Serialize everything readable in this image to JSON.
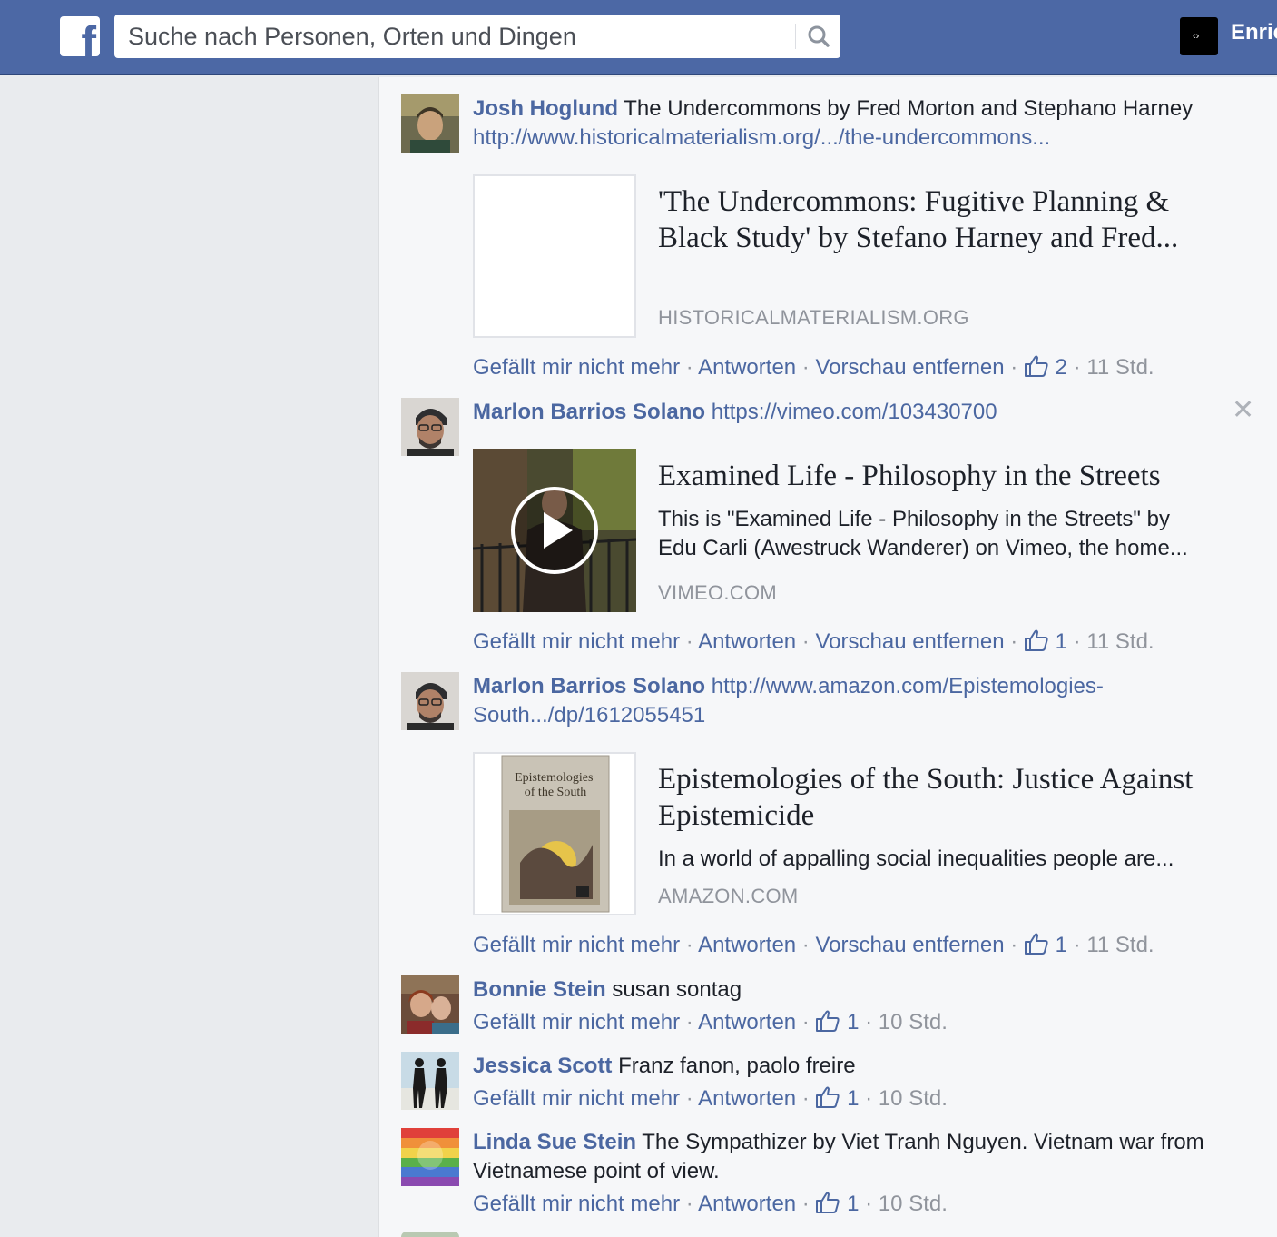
{
  "topbar": {
    "logo_letter": "f",
    "search_placeholder": "Suche nach Personen, Orten und Dingen",
    "user_name": "Enric"
  },
  "actions": {
    "unlike": "Gefällt mir nicht mehr",
    "reply": "Antworten",
    "remove_preview": "Vorschau entfernen",
    "sep": " · "
  },
  "comments": [
    {
      "author": "Josh Hoglund",
      "text": "The Undercommons by Fred Morton and Stephano Harney",
      "link": "http://www.historicalmaterialism.org/.../the-undercommons...",
      "preview": {
        "title": "'The Undercommons: Fugitive Planning & Black Study' by Stefano Harney and Fred...",
        "description": "",
        "domain": "HISTORICALMATERIALISM.ORG"
      },
      "likes": "2",
      "time": "11 Std."
    },
    {
      "author": "Marlon Barrios Solano",
      "text": "",
      "link": "https://vimeo.com/103430700",
      "preview": {
        "title": "Examined Life - Philosophy in the Streets",
        "description": "This is \"Examined Life - Philosophy in the Streets\" by Edu Carli (Awestruck Wanderer) on Vimeo, the home...",
        "domain": "VIMEO.COM"
      },
      "likes": "1",
      "time": "11 Std."
    },
    {
      "author": "Marlon Barrios Solano",
      "text": "",
      "link": "http://www.amazon.com/Epistemologies-South.../dp/1612055451",
      "preview": {
        "title": "Epistemologies of the South: Justice Against Epistemicide",
        "description": "In a world of appalling social inequalities people are...",
        "domain": "AMAZON.COM",
        "book_cover_title": "Epistemologies of the South"
      },
      "likes": "1",
      "time": "11 Std."
    },
    {
      "author": "Bonnie Stein",
      "text": "susan sontag",
      "likes": "1",
      "time": "10 Std."
    },
    {
      "author": "Jessica Scott",
      "text": "Franz fanon, paolo freire",
      "likes": "1",
      "time": "10 Std."
    },
    {
      "author": "Linda Sue Stein",
      "text": "The Sympathizer by Viet Tranh Nguyen. Vietnam war from Vietnamese point of view.",
      "likes": "1",
      "time": "10 Std."
    }
  ],
  "icons": {
    "like": "thumbs-up-icon",
    "search": "search-icon",
    "close": "close-icon",
    "play": "play-icon"
  },
  "colors": {
    "brand": "#4c68a5",
    "link": "#4b67a1",
    "meta": "#90949c"
  }
}
